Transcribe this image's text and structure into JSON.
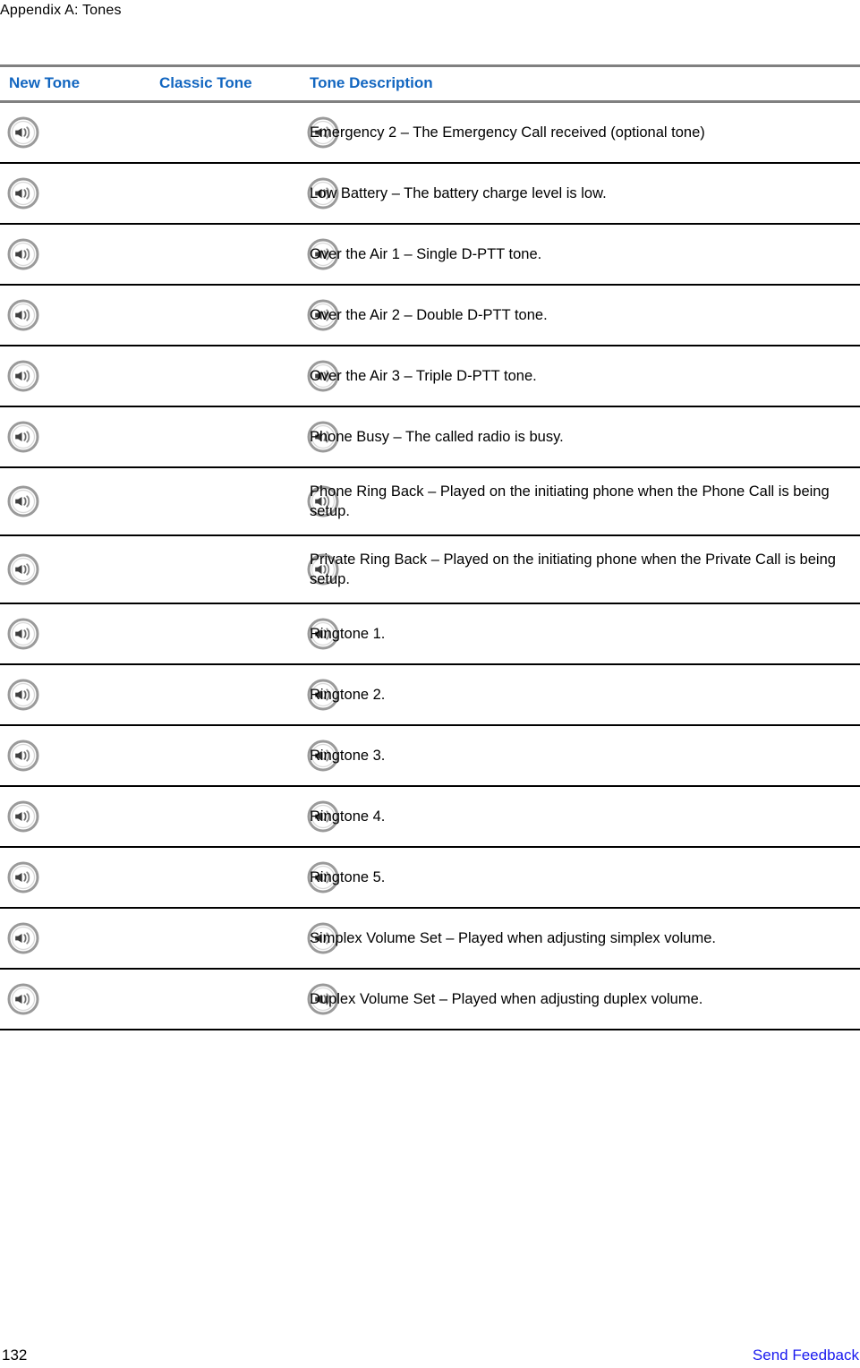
{
  "running_head": "Appendix A: Tones",
  "colors": {
    "header_text": "#1266c0",
    "link": "#1919ef",
    "header_rule": "#808080",
    "row_rule": "#000000",
    "icon_gray": "#8c8c8c",
    "icon_dark": "#3a3a3a"
  },
  "table": {
    "columns": [
      {
        "key": "new_tone",
        "label": "New Tone"
      },
      {
        "key": "classic_tone",
        "label": "Classic Tone"
      },
      {
        "key": "description",
        "label": "Tone Description"
      }
    ],
    "icon_name": "speaker-volume-icon",
    "rows": [
      {
        "new_tone": "speaker-volume-icon",
        "classic_tone": "speaker-volume-icon",
        "description": "Emergency 2 – The Emergency Call received (optional tone)"
      },
      {
        "new_tone": "speaker-volume-icon",
        "classic_tone": "speaker-volume-icon",
        "description": "Low Battery – The battery charge level is low."
      },
      {
        "new_tone": "speaker-volume-icon",
        "classic_tone": "speaker-volume-icon",
        "description": "Over the Air 1 – Single D-PTT tone."
      },
      {
        "new_tone": "speaker-volume-icon",
        "classic_tone": "speaker-volume-icon",
        "description": "Over the Air 2 – Double D-PTT tone."
      },
      {
        "new_tone": "speaker-volume-icon",
        "classic_tone": "speaker-volume-icon",
        "description": "Over the Air 3 – Triple D-PTT tone."
      },
      {
        "new_tone": "speaker-volume-icon",
        "classic_tone": "speaker-volume-icon",
        "description": "Phone Busy – The called radio is busy."
      },
      {
        "new_tone": "speaker-volume-icon",
        "classic_tone": "speaker-volume-icon",
        "description": "Phone Ring Back – Played on the initiating phone when the Phone Call is being setup."
      },
      {
        "new_tone": "speaker-volume-icon",
        "classic_tone": "speaker-volume-icon",
        "description": "Private Ring Back – Played on the initiating phone when the Private Call is being setup."
      },
      {
        "new_tone": "speaker-volume-icon",
        "classic_tone": "speaker-volume-icon",
        "description": "Ringtone 1."
      },
      {
        "new_tone": "speaker-volume-icon",
        "classic_tone": "speaker-volume-icon",
        "description": "Ringtone 2."
      },
      {
        "new_tone": "speaker-volume-icon",
        "classic_tone": "speaker-volume-icon",
        "description": "Ringtone 3."
      },
      {
        "new_tone": "speaker-volume-icon",
        "classic_tone": "speaker-volume-icon",
        "description": "Ringtone 4."
      },
      {
        "new_tone": "speaker-volume-icon",
        "classic_tone": "speaker-volume-icon",
        "description": "Ringtone 5."
      },
      {
        "new_tone": "speaker-volume-icon",
        "classic_tone": "speaker-volume-icon",
        "description": "Simplex Volume Set – Played when adjusting simplex volume."
      },
      {
        "new_tone": "speaker-volume-icon",
        "classic_tone": "speaker-volume-icon",
        "description": "Duplex Volume Set – Played when adjusting duplex volume."
      }
    ]
  },
  "footer": {
    "page_number": "132",
    "feedback_label": "Send Feedback"
  }
}
